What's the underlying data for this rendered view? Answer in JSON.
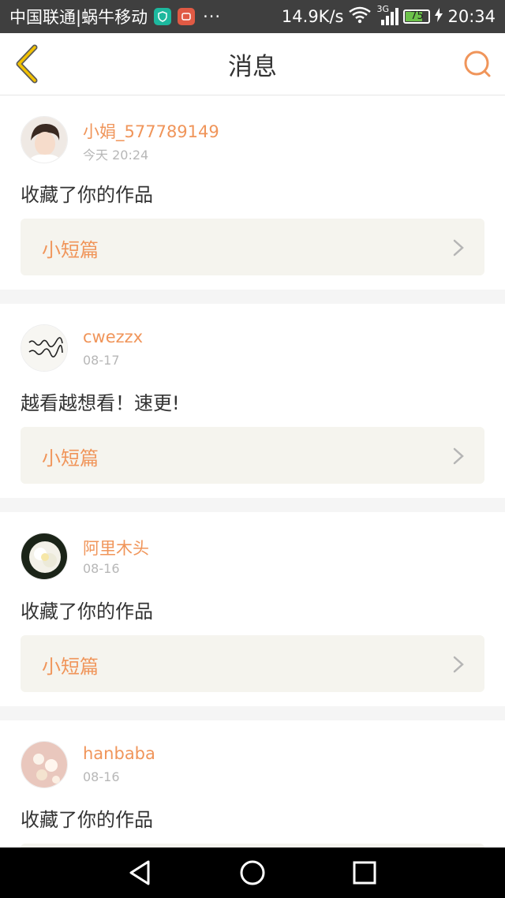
{
  "status_bar": {
    "carrier": "中国联通|蜗牛移动",
    "dots": "···",
    "speed": "14.9K/s",
    "network": "3G",
    "battery": "75",
    "battery_level": 0.75,
    "time": "20:34"
  },
  "header": {
    "title": "消息"
  },
  "colors": {
    "accent": "#f0955a",
    "back_icon": "#f2c100"
  },
  "messages": [
    {
      "username": "小娟_577789149",
      "time": "今天 20:24",
      "text": "收藏了你的作品",
      "work": "小短篇"
    },
    {
      "username": "cwezzx",
      "time": "08-17",
      "text": "越看越想看！速更!",
      "work": "小短篇"
    },
    {
      "username": "阿里木头",
      "time": "08-16",
      "text": "收藏了你的作品",
      "work": "小短篇"
    },
    {
      "username": "hanbaba",
      "time": "08-16",
      "text": "收藏了你的作品",
      "work": ""
    }
  ]
}
